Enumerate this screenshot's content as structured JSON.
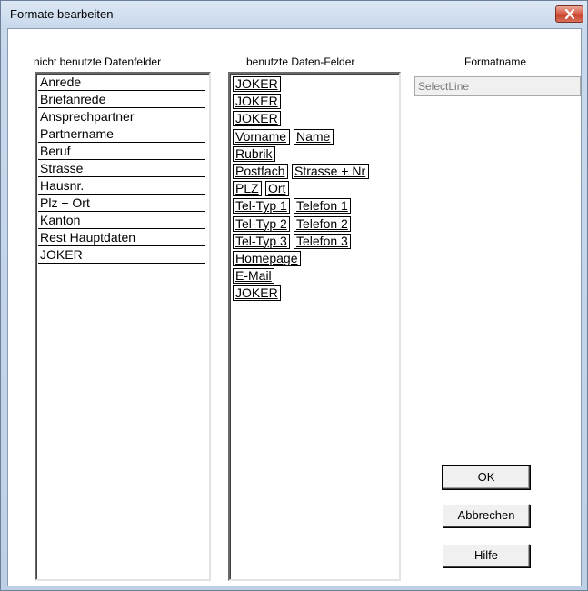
{
  "window": {
    "title": "Formate bearbeiten"
  },
  "labels": {
    "unused": "nicht benutzte Datenfelder",
    "used": "benutzte Daten-Felder",
    "formatname": "Formatname"
  },
  "unused_fields": [
    "Anrede",
    "Briefanrede",
    "Ansprechpartner",
    "Partnername",
    "Beruf",
    "Strasse",
    "Hausnr.",
    "Plz + Ort",
    "Kanton",
    "Rest Hauptdaten",
    "JOKER"
  ],
  "used_fields": [
    [
      "JOKER"
    ],
    [
      "JOKER"
    ],
    [
      "JOKER"
    ],
    [
      "Vorname",
      "Name"
    ],
    [
      "Rubrik"
    ],
    [
      "Postfach",
      "Strasse + Nr"
    ],
    [
      "PLZ",
      "Ort"
    ],
    [
      "Tel-Typ 1",
      "Telefon 1"
    ],
    [
      "Tel-Typ 2",
      "Telefon 2"
    ],
    [
      "Tel-Typ 3",
      "Telefon 3"
    ],
    [
      "Homepage"
    ],
    [
      "E-Mail"
    ],
    [
      "JOKER"
    ]
  ],
  "format_name": {
    "value": "SelectLine"
  },
  "buttons": {
    "ok": "OK",
    "cancel": "Abbrechen",
    "help": "Hilfe"
  },
  "icons": {
    "close": "close-icon"
  },
  "colors": {
    "close_button": "#d8604a",
    "disabled_text": "#7a7a7a"
  }
}
